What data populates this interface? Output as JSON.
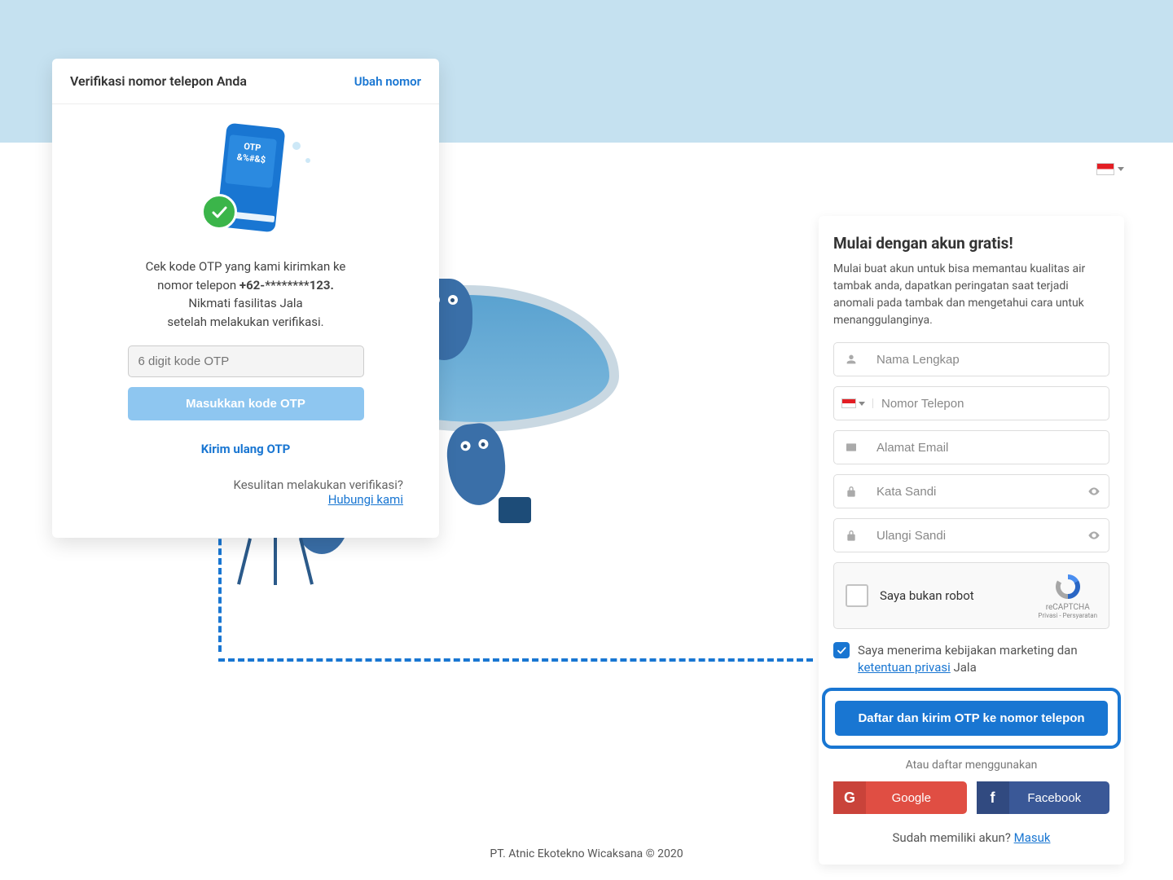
{
  "otp": {
    "title": "Verifikasi nomor telepon Anda",
    "change_label": "Ubah nomor",
    "phone_label_otp": "OTP",
    "phone_label_mask": "&%#&$",
    "msg_line1": "Cek kode OTP yang kami kirimkan ke",
    "msg_line2_prefix": "nomor telepon ",
    "phone_masked": "+62-********123.",
    "msg_line3": "Nikmati fasilitas Jala",
    "msg_line4": "setelah melakukan verifikasi.",
    "input_placeholder": "6 digit kode OTP",
    "submit_label": "Masukkan kode OTP",
    "resend_label": "Kirim ulang OTP",
    "trouble_text": "Kesulitan melakukan verifikasi?",
    "contact_label": "Hubungi kami"
  },
  "signup": {
    "title": "Mulai dengan akun gratis!",
    "description": "Mulai buat akun untuk bisa memantau kualitas air tambak anda, dapatkan peringatan saat terjadi anomali pada tambak dan mengetahui cara untuk menanggulanginya.",
    "fields": {
      "name_placeholder": "Nama Lengkap",
      "phone_placeholder": "Nomor Telepon",
      "email_placeholder": "Alamat Email",
      "password_placeholder": "Kata Sandi",
      "repeat_password_placeholder": "Ulangi Sandi"
    },
    "recaptcha": {
      "label": "Saya bukan robot",
      "brand": "reCAPTCHA",
      "legal": "Privasi - Persyaratan"
    },
    "consent": {
      "text_prefix": "Saya menerima kebijakan marketing dan ",
      "link_text": "ketentuan privasi",
      "text_suffix": " Jala"
    },
    "submit_label": "Daftar dan kirim OTP ke nomor telepon",
    "alt_label": "Atau daftar menggunakan",
    "google_label": "Google",
    "facebook_label": "Facebook",
    "login_prompt": "Sudah memiliki akun? ",
    "login_link": "Masuk"
  },
  "footer": "PT. Atnic Ekotekno Wicaksana © 2020"
}
